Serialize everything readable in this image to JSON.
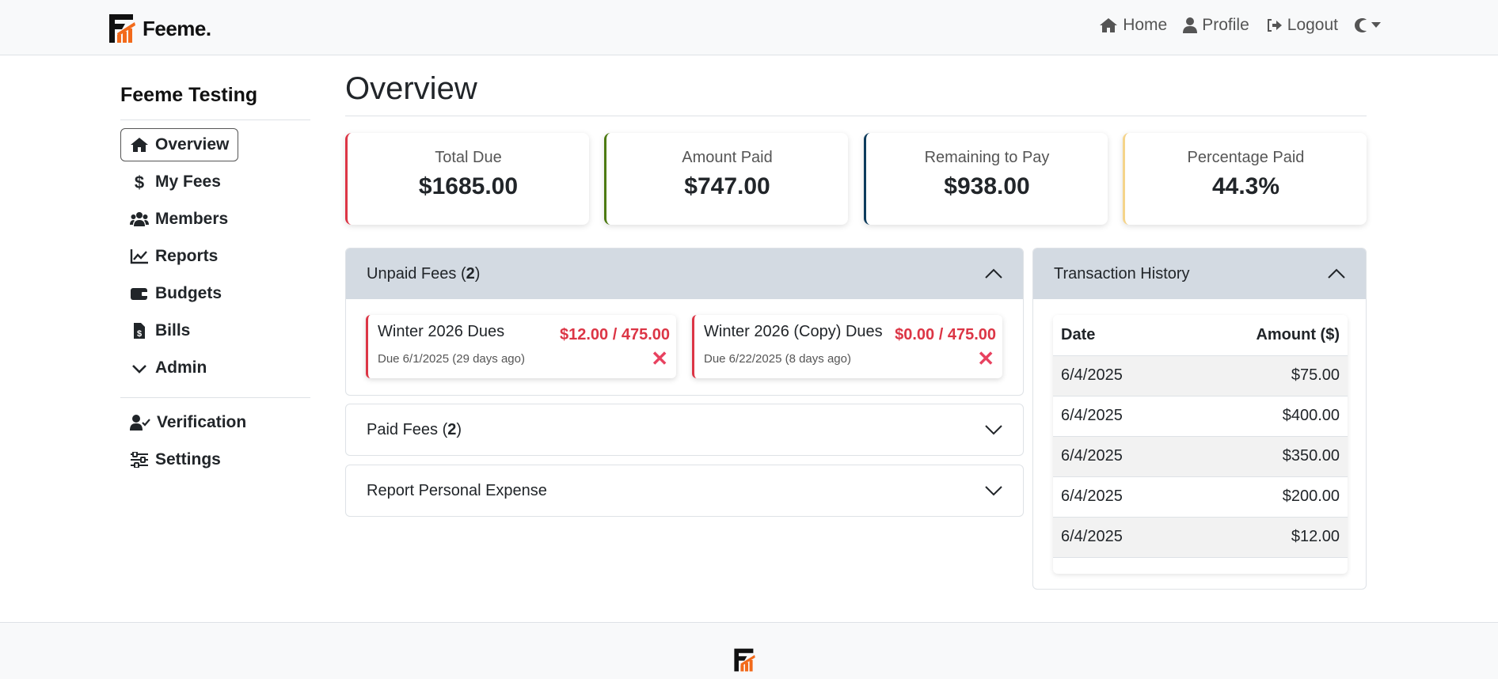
{
  "brand": {
    "name": "Feeme."
  },
  "nav": {
    "home": "Home",
    "profile": "Profile",
    "logout": "Logout"
  },
  "sidebar": {
    "org_name": "Feeme Testing",
    "items": [
      {
        "label": "Overview",
        "icon": "house-icon",
        "active": true
      },
      {
        "label": "My Fees",
        "icon": "dollar-icon"
      },
      {
        "label": "Members",
        "icon": "users-icon"
      },
      {
        "label": "Reports",
        "icon": "chart-line-icon"
      },
      {
        "label": "Budgets",
        "icon": "wallet-icon"
      },
      {
        "label": "Bills",
        "icon": "file-invoice-icon"
      },
      {
        "label": "Admin",
        "icon": "chevron-down-icon"
      }
    ],
    "bottom_items": [
      {
        "label": "Verification",
        "icon": "user-check-icon"
      },
      {
        "label": "Settings",
        "icon": "sliders-icon"
      }
    ]
  },
  "page": {
    "title": "Overview"
  },
  "stats": [
    {
      "label": "Total Due",
      "value": "$1685.00",
      "color": "#dc3545"
    },
    {
      "label": "Amount Paid",
      "value": "$747.00",
      "color": "#4d7a12"
    },
    {
      "label": "Remaining to Pay",
      "value": "$938.00",
      "color": "#0d3b5c"
    },
    {
      "label": "Percentage Paid",
      "value": "44.3%",
      "color": "#f5d48a"
    }
  ],
  "unpaid": {
    "title": "Unpaid Fees (",
    "count": "2",
    "close": ")",
    "fees": [
      {
        "name": "Winter 2026 Dues",
        "amount": "$12.00 / 475.00",
        "due": "Due 6/1/2025 (29 days ago)"
      },
      {
        "name": "Winter 2026 (Copy) Dues",
        "amount": "$0.00 / 475.00",
        "due": "Due 6/22/2025 (8 days ago)"
      }
    ]
  },
  "paid": {
    "title": "Paid Fees (",
    "count": "2",
    "close": ")"
  },
  "expense": {
    "title": "Report Personal Expense"
  },
  "transactions": {
    "title": "Transaction History",
    "col_date": "Date",
    "col_amount": "Amount ($)",
    "rows": [
      {
        "date": "6/4/2025",
        "amount": "$75.00"
      },
      {
        "date": "6/4/2025",
        "amount": "$400.00"
      },
      {
        "date": "6/4/2025",
        "amount": "$350.00"
      },
      {
        "date": "6/4/2025",
        "amount": "$200.00"
      },
      {
        "date": "6/4/2025",
        "amount": "$12.00"
      }
    ]
  },
  "colors": {
    "accent_red": "#dc3545",
    "panel_header": "#d3dae2",
    "logo_orange": "#f26a1b"
  }
}
